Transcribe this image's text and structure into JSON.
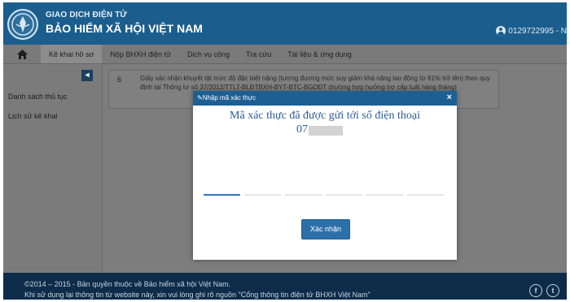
{
  "header": {
    "brand_top": "GIAO DỊCH ĐIỆN TỬ",
    "brand_main": "BẢO HIỂM XÃ HỘI VIỆT NAM",
    "account": "0129722995 - N",
    "logo_icon": "bhxh-logo-icon",
    "user_icon": "user-icon"
  },
  "nav": {
    "home_icon": "home-icon",
    "items": [
      {
        "label": "Kê khai hồ sơ"
      },
      {
        "label": "Nộp BHXH điện tử"
      },
      {
        "label": "Dịch vụ công"
      },
      {
        "label": "Tra cứu"
      },
      {
        "label": "Tài liệu & ứng dụng"
      }
    ]
  },
  "sidebar": {
    "toggle_icon": "collapse-icon",
    "items": [
      {
        "label": "Danh sách thủ tục"
      },
      {
        "label": "Lịch sử kê khai"
      }
    ]
  },
  "table": {
    "row_number": "6",
    "row_text": "Giấy xác nhận khuyết tật mức độ đặc biệt nặng (tương đương mức suy giảm khả năng lao động từ 81% trở lên) theo quy định tại Thông tư số 37/2012/TTLT-BLĐTBXH-BYT-BTC-BGDĐT (trường hợp hưởng trợ cấp tuất hàng tháng)"
  },
  "modal": {
    "title": "Nhập mã xác thực",
    "close": "×",
    "message": "Mã xác thực đã được gửi tới số điện thoại",
    "phone_prefix": "07",
    "otp_slots": 6,
    "confirm": "Xác nhận"
  },
  "footer": {
    "line1": "©2014 – 2015 - Bản quyền thuộc về Bảo hiểm xã hội Việt Nam.",
    "line2": "Khi sử dụng lại thông tin từ website này, xin vui lòng ghi rõ nguồn \"Cổng thông tin điện tử BHXH Việt Nam\"",
    "facebook_icon": "facebook-icon",
    "twitter_icon": "twitter-icon"
  },
  "colors": {
    "header": "#1b5e8e",
    "modal_header": "#1d5f93",
    "accent": "#2e79c2",
    "footer": "#0d2c4a"
  }
}
